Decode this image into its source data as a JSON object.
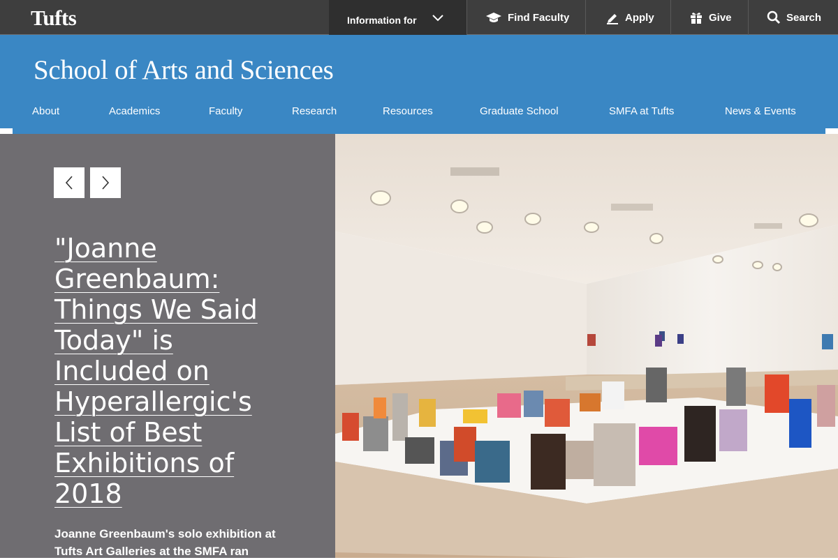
{
  "topbar": {
    "logo": "Tufts",
    "information_for": "Information for",
    "find_faculty": "Find Faculty",
    "apply": "Apply",
    "give": "Give",
    "search": "Search"
  },
  "header": {
    "school_name": "School of Arts and Sciences",
    "nav": [
      "About",
      "Academics",
      "Faculty",
      "Research",
      "Resources",
      "Graduate School",
      "SMFA at Tufts",
      "News & Events"
    ]
  },
  "hero": {
    "prev_label": "‹",
    "next_label": "›",
    "headline": "\"Joanne Greenbaum: Things We Said Today\" is Included on Hyperallergic's List of Best Exhibitions of 2018",
    "summary": "Joanne Greenbaum's solo exhibition at Tufts Art Galleries at the SMFA ran",
    "photo_icon": "gallery-exhibition-photo"
  },
  "colors": {
    "topbar": "#3e3e3e",
    "brand_blue": "#3a87c4",
    "hero_gray": "#6f6d71"
  }
}
